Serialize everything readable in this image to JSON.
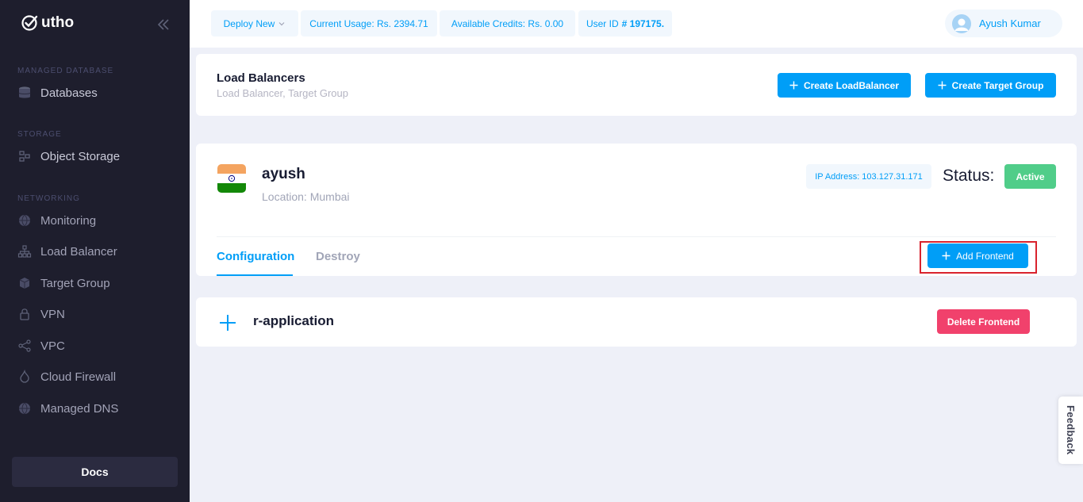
{
  "brand": {
    "name": "utho"
  },
  "sidebar": {
    "sections": [
      {
        "label": "MANAGED DATABASE",
        "items": [
          {
            "label": "Databases",
            "icon": "database-icon"
          }
        ]
      },
      {
        "label": "STORAGE",
        "items": [
          {
            "label": "Object Storage",
            "icon": "storage-icon"
          }
        ]
      },
      {
        "label": "NETWORKING",
        "items": [
          {
            "label": "Monitoring",
            "icon": "globe-icon"
          },
          {
            "label": "Load Balancer",
            "icon": "sitemap-icon"
          },
          {
            "label": "Target Group",
            "icon": "cube-icon"
          },
          {
            "label": "VPN",
            "icon": "lock-icon"
          },
          {
            "label": "VPC",
            "icon": "share-icon"
          },
          {
            "label": "Cloud Firewall",
            "icon": "flame-icon"
          },
          {
            "label": "Managed DNS",
            "icon": "globe-icon"
          }
        ]
      }
    ],
    "docs_label": "Docs"
  },
  "header": {
    "deploy_label": "Deploy New",
    "usage_label": "Current Usage: Rs. 2394.71",
    "credits_label": "Available Credits: Rs. 0.00",
    "user_id_prefix": "User ID",
    "user_id_value": "# 197175.",
    "user_name": "Ayush Kumar"
  },
  "page": {
    "title": "Load Balancers",
    "subtitle": "Load Balancer, Target Group",
    "create_lb_label": "Create LoadBalancer",
    "create_tg_label": "Create Target Group"
  },
  "load_balancer": {
    "name": "ayush",
    "location": "Location: Mumbai",
    "ip": "IP Address: 103.127.31.171",
    "status_label": "Status:",
    "status": "Active",
    "tabs": [
      "Configuration",
      "Destroy"
    ],
    "add_frontend_label": "Add Frontend"
  },
  "frontend": {
    "name": "r-application",
    "delete_label": "Delete Frontend"
  },
  "feedback_label": "Feedback",
  "colors": {
    "primary": "#009ef7",
    "success": "#50cd89",
    "danger": "#f1416c",
    "sidebar": "#1e1e2d",
    "highlight": "#d9232d"
  }
}
